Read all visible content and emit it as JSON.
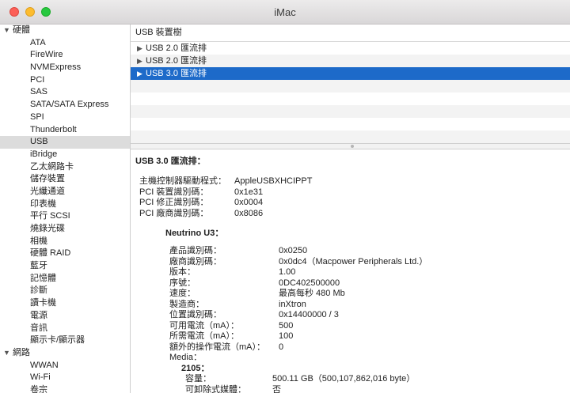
{
  "window": {
    "title": "iMac"
  },
  "sidebar": {
    "groups": [
      {
        "label": "硬體",
        "items": [
          "ATA",
          "FireWire",
          "NVMExpress",
          "PCI",
          "SAS",
          "SATA/SATA Express",
          "SPI",
          "Thunderbolt",
          "USB",
          "iBridge",
          "乙太網路卡",
          "儲存裝置",
          "光纖通道",
          "印表機",
          "平行 SCSI",
          "燒錄光碟",
          "相機",
          "硬體 RAID",
          "藍牙",
          "記憶體",
          "診斷",
          "讀卡機",
          "電源",
          "音訊",
          "顯示卡/顯示器"
        ]
      },
      {
        "label": "網路",
        "items": [
          "WWAN",
          "Wi-Fi",
          "卷宗"
        ]
      }
    ],
    "selected": "USB"
  },
  "tree": {
    "header": "USB 裝置樹",
    "rows": [
      "USB 2.0 匯流排",
      "USB 2.0 匯流排",
      "USB 3.0 匯流排"
    ],
    "selected_index": 2
  },
  "detail": {
    "title": "USB 3.0 匯流排：",
    "bus_props": [
      {
        "k": "主機控制器驅動程式：",
        "v": "AppleUSBXHCIPPT"
      },
      {
        "k": "PCI 裝置識別碼：",
        "v": "0x1e31"
      },
      {
        "k": "PCI 修正識別碼：",
        "v": "0x0004"
      },
      {
        "k": "PCI 廠商識別碼：",
        "v": "0x8086"
      }
    ],
    "device_title": "Neutrino U3：",
    "device_props": [
      {
        "k": "產品識別碼：",
        "v": "0x0250"
      },
      {
        "k": "廠商識別碼：",
        "v": "0x0dc4（Macpower Peripherals Ltd.）"
      },
      {
        "k": "版本：",
        "v": "1.00"
      },
      {
        "k": "序號：",
        "v": "0DC402500000"
      },
      {
        "k": "速度：",
        "v": "最高每秒 480 Mb"
      },
      {
        "k": "製造商：",
        "v": "inXtron"
      },
      {
        "k": "位置識別碼：",
        "v": "0x14400000 / 3"
      },
      {
        "k": "可用電流（mA）：",
        "v": "500"
      },
      {
        "k": "所需電流（mA）：",
        "v": "100"
      },
      {
        "k": "額外的操作電流（mA）：",
        "v": "0"
      }
    ],
    "media_label": "Media：",
    "media_name": "2105：",
    "media_props": [
      {
        "k": "容量：",
        "v": "500.11 GB（500,107,862,016 byte）"
      },
      {
        "k": "可卸除式媒體：",
        "v": "否"
      }
    ]
  }
}
